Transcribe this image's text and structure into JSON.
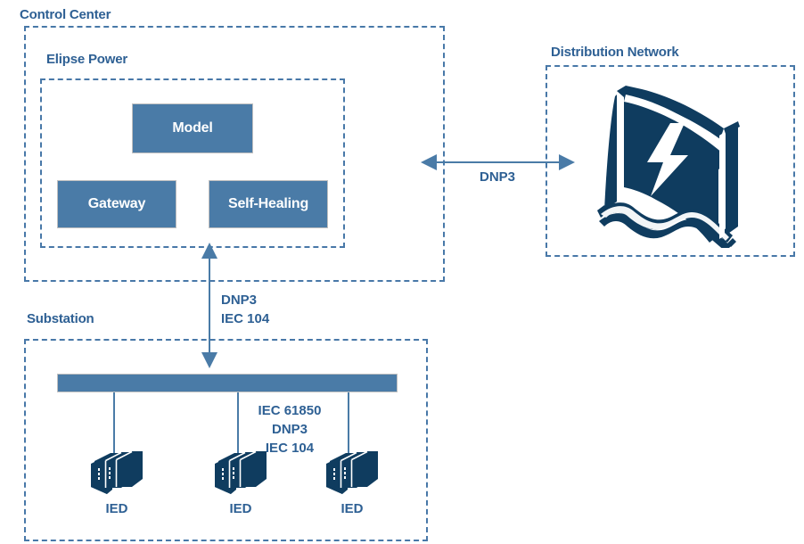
{
  "diagram": {
    "title_hidden": "",
    "colors": {
      "accent_blue": "#4A7BA7",
      "label_blue": "#2E6094",
      "dashed_border": "#4878A8",
      "icon_navy": "#0F3C5F",
      "box_text": "#FFFFFF",
      "background": "#FFFFFF"
    }
  },
  "control_center": {
    "label": "Control Center",
    "elipse_power": {
      "label": "Elipse Power",
      "boxes": [
        {
          "label": "Model"
        },
        {
          "label": "Gateway"
        },
        {
          "label": "Self-Healing"
        }
      ]
    }
  },
  "distribution_network": {
    "label": "Distribution Network",
    "icon": "power-grid-icon"
  },
  "substation": {
    "label": "Substation",
    "bus_bar": "substation-bus",
    "devices": [
      {
        "label": "IED",
        "icon": "server-stack-icon"
      },
      {
        "label": "IED",
        "icon": "server-stack-icon"
      },
      {
        "label": "IED",
        "icon": "server-stack-icon"
      }
    ],
    "inner_protocols": "IEC 61850\nDNP3\nIEC 104",
    "inner_protocols_lines": [
      "IEC 61850",
      "DNP3",
      "IEC 104"
    ]
  },
  "connections": {
    "cc_to_dn": {
      "label": "DNP3",
      "arrow": "double-headed-horizontal-arrow"
    },
    "cc_to_substation": {
      "label_lines": [
        "DNP3",
        "IEC 104"
      ],
      "line1": "DNP3",
      "line2": "IEC 104",
      "arrow": "double-headed-vertical-arrow"
    }
  }
}
